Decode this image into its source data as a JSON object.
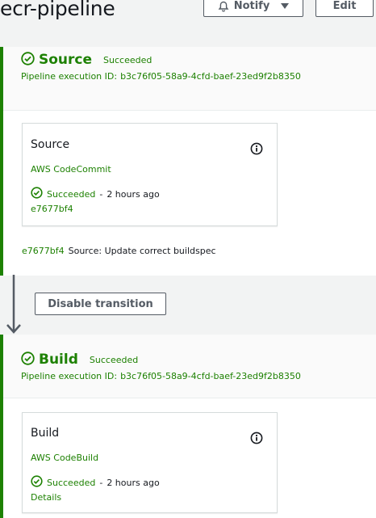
{
  "header": {
    "title": "ecr-pipeline",
    "notify_label": "Notify",
    "edit_label": "Edit"
  },
  "stages": [
    {
      "name": "Source",
      "status": "Succeeded",
      "exec_label": "Pipeline execution ID:",
      "exec_id": "b3c76f05-58a9-4cfd-baef-23ed9f2b8350",
      "action": {
        "name": "Source",
        "provider": "AWS CodeCommit",
        "status": "Succeeded",
        "separator": "-",
        "time_ago": "2 hours ago",
        "link": "e7677bf4"
      },
      "commit": {
        "id": "e7677bf4",
        "message": "Source: Update correct buildspec"
      }
    },
    {
      "name": "Build",
      "status": "Succeeded",
      "exec_label": "Pipeline execution ID:",
      "exec_id": "b3c76f05-58a9-4cfd-baef-23ed9f2b8350",
      "action": {
        "name": "Build",
        "provider": "AWS CodeBuild",
        "status": "Succeeded",
        "separator": "-",
        "time_ago": "2 hours ago",
        "link": "Details"
      }
    }
  ],
  "transition": {
    "disable_label": "Disable transition"
  },
  "colors": {
    "success": "#1d8102",
    "text": "#16191f",
    "button_border": "#545b64"
  },
  "icons": {
    "notify": "bell-icon",
    "dropdown": "caret-down-icon",
    "status": "check-circle-icon",
    "info": "info-icon",
    "arrow": "arrow-down-icon"
  }
}
